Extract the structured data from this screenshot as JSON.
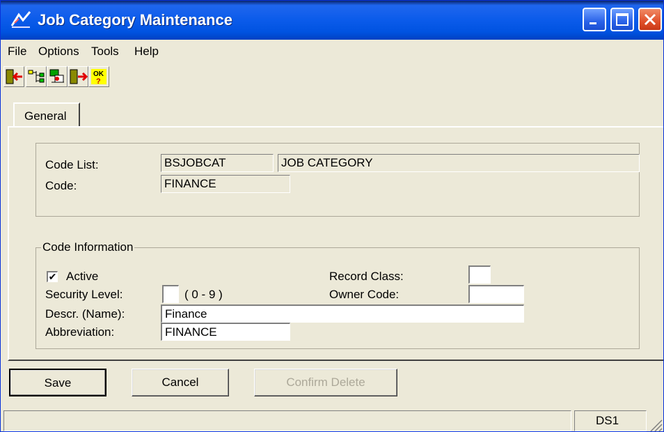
{
  "window": {
    "title": "Job Category Maintenance"
  },
  "icons": {
    "app": "app-icon",
    "minimize": "minimize-icon",
    "maximize": "maximize-icon",
    "close": "close-icon"
  },
  "menu": [
    "File",
    "Options",
    "Tools",
    "Help"
  ],
  "toolbar": [
    {
      "name": "exit-icon"
    },
    {
      "name": "tree-icon"
    },
    {
      "name": "lookup-icon"
    },
    {
      "name": "exit-right-icon"
    },
    {
      "name": "ok-icon"
    }
  ],
  "tab": {
    "general": "General"
  },
  "header": {
    "code_list_label": "Code List:",
    "code_list_value": "BSJOBCAT",
    "code_list_desc": "JOB CATEGORY",
    "code_label": "Code:",
    "code_value": "FINANCE"
  },
  "code_info": {
    "group_title": "Code Information",
    "active_label": "Active",
    "active_checked": true,
    "active_mark": "✔",
    "security_label": "Security Level:",
    "security_value": "",
    "security_range": "( 0 - 9 )",
    "descr_label": "Descr. (Name):",
    "descr_value": "Finance",
    "abbrev_label": "Abbreviation:",
    "abbrev_value": "FINANCE",
    "record_class_label": "Record Class:",
    "record_class_value": "",
    "owner_code_label": "Owner Code:",
    "owner_code_value": ""
  },
  "buttons": {
    "save": "Save",
    "cancel": "Cancel",
    "confirm_delete": "Confirm Delete"
  },
  "status": {
    "right_pane": "DS1"
  }
}
